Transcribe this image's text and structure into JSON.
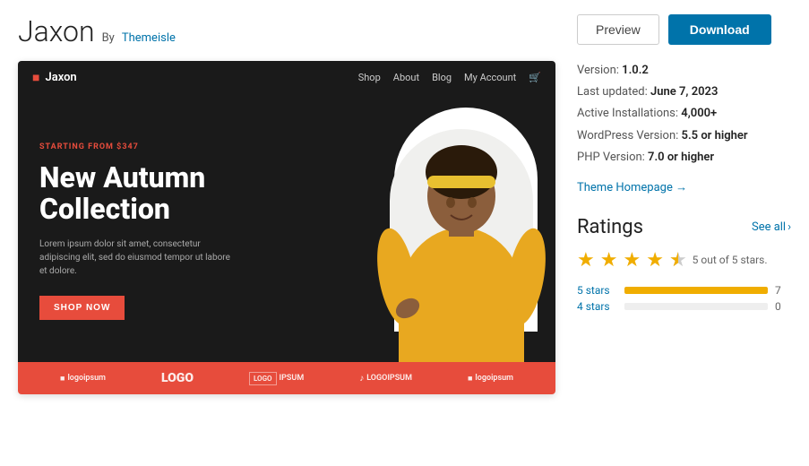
{
  "theme": {
    "name": "Jaxon",
    "by": "By",
    "author": "Themeisle",
    "version": "1.0.2",
    "last_updated_label": "Last updated:",
    "last_updated_value": "June 7, 2023",
    "active_installs_label": "Active Installations:",
    "active_installs_value": "4,000+",
    "wp_version_label": "WordPress Version:",
    "wp_version_value": "5.5 or higher",
    "php_version_label": "PHP Version:",
    "php_version_value": "7.0 or higher",
    "homepage_link": "Theme Homepage →"
  },
  "buttons": {
    "preview": "Preview",
    "download": "Download"
  },
  "preview_nav": {
    "logo": "Jaxon",
    "links": [
      "Shop",
      "About",
      "Blog",
      "My Account"
    ]
  },
  "hero": {
    "starting": "STARTING FROM $347",
    "title": "New Autumn Collection",
    "desc": "Lorem ipsum dolor sit amet, consectetur adipiscing elit, sed do eiusmod tempor ut labore et dolore.",
    "cta": "SHOP NOW"
  },
  "logos": [
    "logoipsum",
    "LOGO",
    "LOGO IPSUM",
    "LOGOIPSUM",
    "logoipsum"
  ],
  "ratings": {
    "title": "Ratings",
    "see_all": "See all",
    "stars_label": "5 out of 5 stars.",
    "bars": [
      {
        "label": "5 stars",
        "pct": 100,
        "count": 7
      },
      {
        "label": "4 stars",
        "pct": 0,
        "count": 0
      }
    ]
  },
  "colors": {
    "accent": "#0073aa",
    "download_bg": "#0073aa",
    "star": "#f0ad00",
    "hero_bg": "#1a1a1a",
    "red": "#e74c3c"
  }
}
